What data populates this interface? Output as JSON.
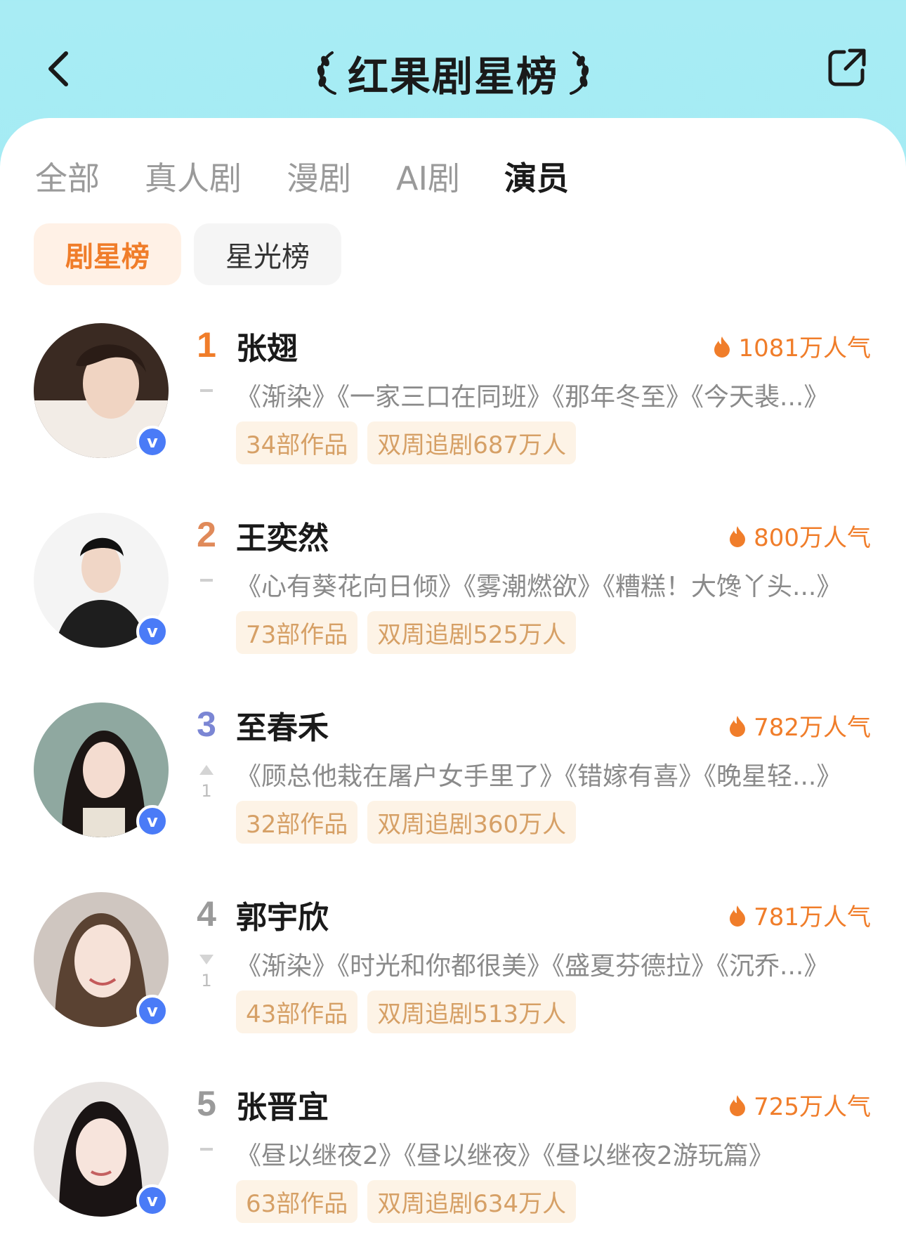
{
  "header": {
    "title": "红果剧星榜"
  },
  "tabs": [
    {
      "label": "全部",
      "active": false
    },
    {
      "label": "真人剧",
      "active": false
    },
    {
      "label": "漫剧",
      "active": false
    },
    {
      "label": "AI剧",
      "active": false
    },
    {
      "label": "演员",
      "active": true
    }
  ],
  "subtabs": [
    {
      "label": "剧星榜",
      "active": true
    },
    {
      "label": "星光榜",
      "active": false
    }
  ],
  "colors": {
    "accent": "#f07d2a",
    "rank1": "#f07d2a",
    "rank2": "#e08a5a",
    "rank3": "#7b86d4",
    "rank_other": "#9a9a9a",
    "verified": "#4a7bf7"
  },
  "list": [
    {
      "rank": "1",
      "name": "张翅",
      "popularity": "1081万人气",
      "trend": "-",
      "trend_num": "",
      "works": "《渐染》《一家三口在同班》《那年冬至》《今天裴...》",
      "works_count": "34部作品",
      "weekly": "双周追剧687万人"
    },
    {
      "rank": "2",
      "name": "王奕然",
      "popularity": "800万人气",
      "trend": "-",
      "trend_num": "",
      "works": "《心有葵花向日倾》《雾潮燃欲》《糟糕！大馋丫头...》",
      "works_count": "73部作品",
      "weekly": "双周追剧525万人"
    },
    {
      "rank": "3",
      "name": "至春禾",
      "popularity": "782万人气",
      "trend": "up",
      "trend_num": "1",
      "works": "《顾总他栽在屠户女手里了》《错嫁有喜》《晚星轻...》",
      "works_count": "32部作品",
      "weekly": "双周追剧360万人"
    },
    {
      "rank": "4",
      "name": "郭宇欣",
      "popularity": "781万人气",
      "trend": "down",
      "trend_num": "1",
      "works": "《渐染》《时光和你都很美》《盛夏芬德拉》《沉乔...》",
      "works_count": "43部作品",
      "weekly": "双周追剧513万人"
    },
    {
      "rank": "5",
      "name": "张晋宜",
      "popularity": "725万人气",
      "trend": "-",
      "trend_num": "",
      "works": "《昼以继夜2》《昼以继夜》《昼以继夜2游玩篇》",
      "works_count": "63部作品",
      "weekly": "双周追剧634万人"
    }
  ]
}
